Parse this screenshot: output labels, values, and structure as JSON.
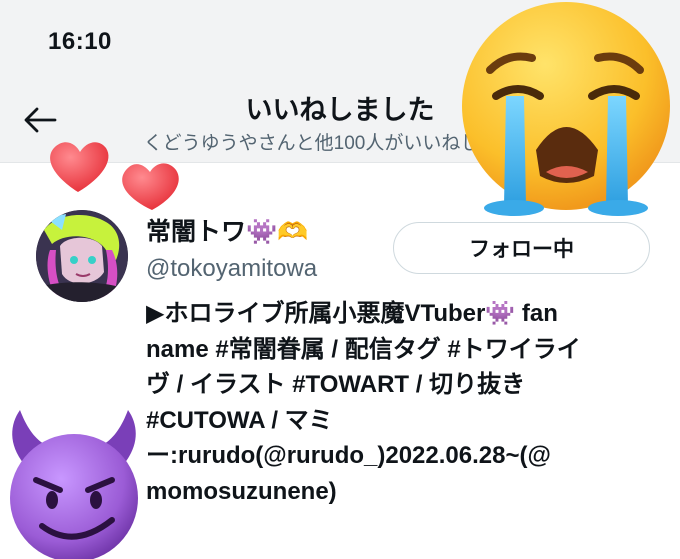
{
  "status_bar": {
    "time": "16:10"
  },
  "header": {
    "back_icon": "arrow-left-icon",
    "title": "いいねしました",
    "subtitle": "くどうゆうやさんと他100人がいいねしました"
  },
  "user": {
    "display_name": "常闇トワ👾🫶",
    "handle": "@tokoyamitowa",
    "follow_label": "フォロー中",
    "bio_lines": [
      "▶ホロライブ所属小悪魔VTuber👾 fan",
      "name #常闇眷属 / 配信タグ #トワイライ",
      "ヴ / イラスト #TOWART / 切り抜き",
      "#CUTOWA / マミ",
      "ー:rurudo(@rurudo_)2022.06.28~(@",
      "momosuzunene)"
    ]
  },
  "stickers": {
    "hearts": "two-hearts-icon",
    "crying": "loudly-crying-face-icon",
    "devil": "smiling-face-with-horns-icon"
  },
  "colors": {
    "background": "#ffffff",
    "header_bg": "#f2f3f4",
    "secondary_text": "#536471",
    "heart": "#f0484f",
    "devil_purple": "#9b5cd6"
  }
}
